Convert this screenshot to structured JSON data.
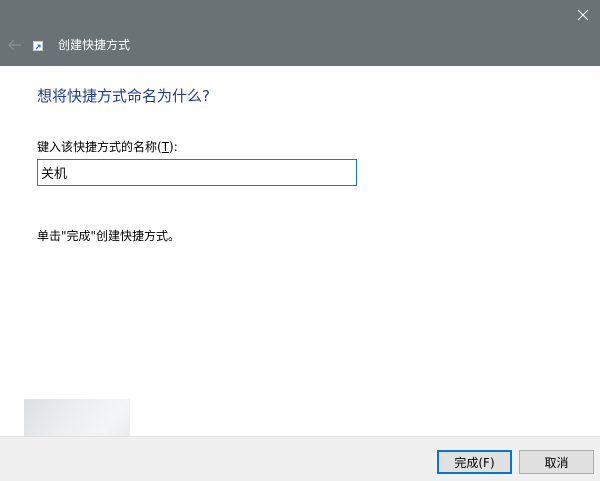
{
  "window": {
    "title": "创建快捷方式",
    "close_symbol": "✕"
  },
  "icons": {
    "back": "back-arrow-icon",
    "app": "shortcut-icon",
    "close": "close-icon"
  },
  "content": {
    "heading": "想将快捷方式命名为什么?",
    "field_label_prefix": "键入该快捷方式的名称(",
    "field_label_key": "T",
    "field_label_suffix": "):",
    "name_value": "关机",
    "hint": "单击\"完成\"创建快捷方式。"
  },
  "buttons": {
    "finish_label": "完成(F)",
    "cancel_label": "取消"
  },
  "colors": {
    "titlebar": "#6a7276",
    "heading": "#1e3d8f",
    "focus": "#1979ca"
  }
}
